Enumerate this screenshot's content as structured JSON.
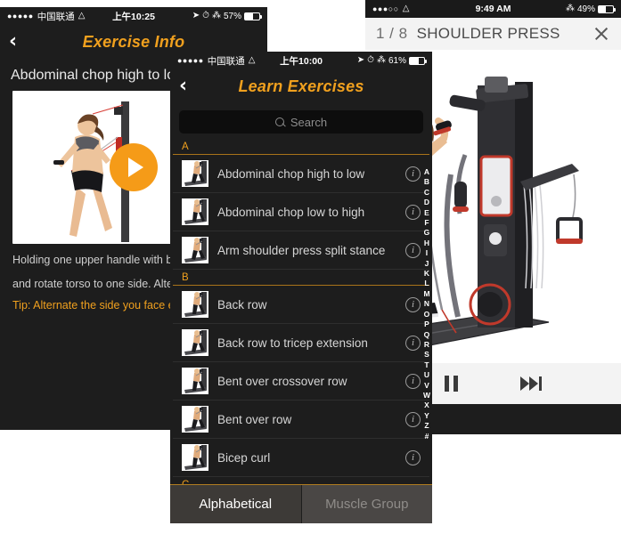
{
  "theme": {
    "accent": "#f0a01e",
    "dark_bg": "#1d1d1d",
    "light_bar": "#f3f3f3",
    "play_orange": "#f59b18"
  },
  "left_phone": {
    "statusbar": {
      "dots": "●●●●●",
      "carrier": "中国联通",
      "wifi": "wifi-icon",
      "time": "上午10:25",
      "location": "location-icon",
      "alarm": "alarm-icon",
      "bluetooth": "bluetooth-icon",
      "battery": "57%"
    },
    "nav": {
      "back": "‹",
      "title": "Exercise Info"
    },
    "exercise_title": "Abdominal chop high to low",
    "video": {
      "play_label": "play-icon"
    },
    "description_line1": "Holding one upper handle with bo",
    "description_line2": "and rotate torso to one side. Alter",
    "tip": "Tip: Alternate the side you face ea"
  },
  "mid_phone": {
    "statusbar": {
      "dots": "●●●●●",
      "carrier": "中国联通",
      "wifi": "wifi-icon",
      "time": "上午10:00",
      "location": "location-icon",
      "alarm": "alarm-icon",
      "bluetooth": "bluetooth-icon",
      "battery": "61%"
    },
    "nav": {
      "back": "‹",
      "title": "Learn Exercises"
    },
    "search": {
      "placeholder": "Search",
      "value": ""
    },
    "sections": [
      {
        "letter": "A",
        "items": [
          {
            "name": "Abdominal chop high to low",
            "info": "i"
          },
          {
            "name": "Abdominal chop low to high",
            "info": "i"
          },
          {
            "name": "Arm shoulder press split stance",
            "info": "i"
          }
        ]
      },
      {
        "letter": "B",
        "items": [
          {
            "name": "Back row",
            "info": "i"
          },
          {
            "name": "Back row to tricep extension",
            "info": "i"
          },
          {
            "name": "Bent over crossover row",
            "info": "i"
          },
          {
            "name": "Bent over row",
            "info": "i"
          },
          {
            "name": "Bicep curl",
            "info": "i"
          }
        ]
      },
      {
        "letter": "C",
        "items": []
      }
    ],
    "alpha_index": [
      "A",
      "B",
      "C",
      "D",
      "E",
      "F",
      "G",
      "H",
      "I",
      "J",
      "K",
      "L",
      "M",
      "N",
      "O",
      "P",
      "Q",
      "R",
      "S",
      "T",
      "U",
      "V",
      "W",
      "X",
      "Y",
      "Z",
      "#"
    ],
    "tabs": [
      {
        "label": "Alphabetical",
        "active": true
      },
      {
        "label": "Muscle Group",
        "active": false
      }
    ]
  },
  "right_phone": {
    "statusbar": {
      "dots": "●●●○○",
      "wifi": "wifi-icon",
      "time": "9:49 AM",
      "bluetooth": "bluetooth-icon",
      "battery": "49%"
    },
    "header": {
      "counter": "1 / 8",
      "title": "SHOULDER PRESS",
      "close": "close-icon"
    },
    "controls": {
      "pause": "pause-icon",
      "next": "next-track-icon"
    }
  }
}
